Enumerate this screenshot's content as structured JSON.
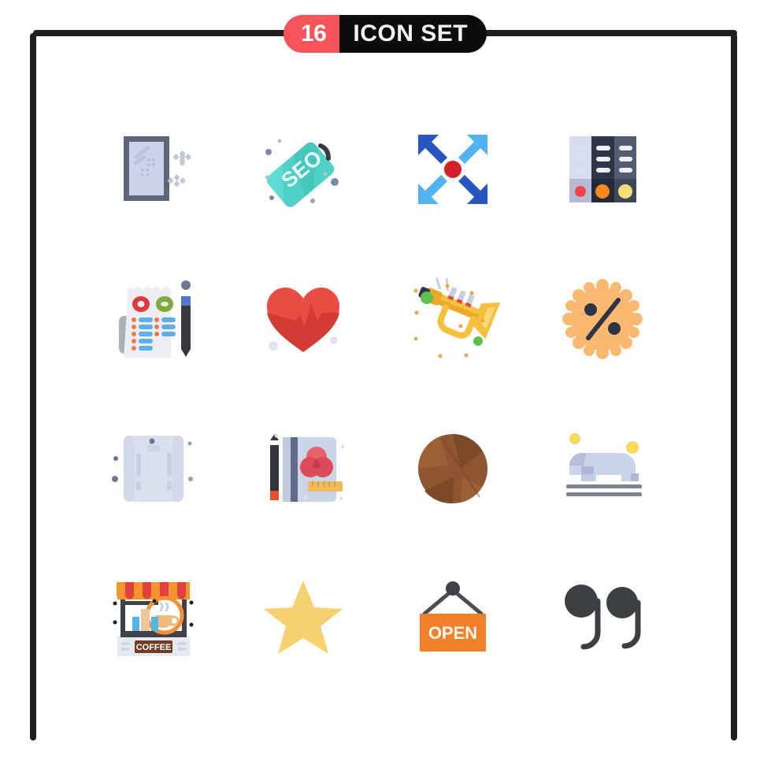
{
  "header": {
    "count": "16",
    "title": "ICON SET",
    "count_bg": "#f4545a",
    "title_bg": "#0d0c0c",
    "text_color": "#ffffff"
  },
  "frame": {
    "color": "#231f20"
  },
  "icons": [
    {
      "name": "window-cleaning-icon",
      "label": "Window Cleaning",
      "row": 1,
      "col": 1,
      "colors": {
        "frame": "#5e6577",
        "glass": "#ccd3ea",
        "streak": "#b9c2de",
        "sparkle": "#c0c7d8"
      }
    },
    {
      "name": "seo-tag-icon",
      "label": "SEO Tag",
      "row": 1,
      "col": 2,
      "text": "SEO",
      "colors": {
        "tag": "#4fd1c6",
        "tag_dark": "#3fc0b5",
        "string": "#393b45",
        "dot": "#7d88a3",
        "dot_light": "#cfd5e4",
        "letters": "#e8faf7"
      }
    },
    {
      "name": "converge-arrows-icon",
      "label": "Converge Arrows",
      "row": 1,
      "col": 3,
      "colors": {
        "dark_blue": "#2855c0",
        "light_blue": "#53b3f0",
        "center": "#d32027"
      }
    },
    {
      "name": "binders-archive-icon",
      "label": "Binders Archive",
      "row": 1,
      "col": 4,
      "colors": {
        "binder_light": "#d7dcef",
        "binder_dark": "#2d3547",
        "binder_slate": "#525d74",
        "base_light": "#b3bcd4",
        "line": "#eef1fb",
        "dot_red": "#f0464a",
        "dot_orange": "#f5881f",
        "dot_yellow": "#fbde78"
      }
    },
    {
      "name": "survey-checklist-icon",
      "label": "Survey Checklist",
      "row": 2,
      "col": 1,
      "colors": {
        "paper": "#eceef3",
        "paper_shadow": "#a9afbd",
        "red": "#e0393c",
        "green": "#7dab3b",
        "bullet": "#e97a4a",
        "line": "#5eaeea",
        "pencil_body": "#38383c",
        "pencil_tip": "#4c79d0"
      }
    },
    {
      "name": "heartbeat-icon",
      "label": "Heartbeat",
      "row": 2,
      "col": 2,
      "colors": {
        "heart": "#e84c43",
        "heart_dark": "#d23c35",
        "dot": "#dfe3ec"
      }
    },
    {
      "name": "trumpet-icon",
      "label": "Trumpet",
      "row": 2,
      "col": 3,
      "colors": {
        "brass": "#f5c13c",
        "brass_dark": "#eaa92c",
        "brass_light": "#fad97a",
        "valve": "#c8d0e0",
        "mouth": "#2f3550",
        "confetti_green": "#5fc04f",
        "confetti_orange": "#f0a44c"
      }
    },
    {
      "name": "discount-badge-icon",
      "label": "Discount Badge",
      "row": 2,
      "col": 4,
      "colors": {
        "badge": "#fbb871",
        "symbol": "#2e3448"
      }
    },
    {
      "name": "scroll-manuscript-icon",
      "label": "Scroll Manuscript",
      "row": 3,
      "col": 1,
      "colors": {
        "paper": "#dbe0ee",
        "paper_dark": "#ccd3e6",
        "rod": "#c1c9dd",
        "dot": "#6d7793",
        "dot_light": "#c5cbdb"
      }
    },
    {
      "name": "sketchbook-icon",
      "label": "Sketchbook",
      "row": 3,
      "col": 2,
      "colors": {
        "cover": "#ccd4e8",
        "spine": "#5f6a86",
        "pencil": "#33353c",
        "pencil_tip": "#e8502a",
        "circle_a": "#e8606c",
        "circle_b": "#dd4a59",
        "circle_c": "#c53a4c",
        "ruler": "#f0b95e",
        "dot": "#dde2ee"
      }
    },
    {
      "name": "basketball-icon",
      "label": "Basketball",
      "row": 3,
      "col": 3,
      "colors": {
        "ball": "#8e5630",
        "ball_dark": "#7d4a28",
        "ball_light": "#9a6036"
      }
    },
    {
      "name": "crawling-baby-icon",
      "label": "Crawling Baby",
      "row": 3,
      "col": 4,
      "colors": {
        "body": "#ccd4ea",
        "body_dark": "#aeb9d6",
        "mat": "#7d8391",
        "sun": "#fbd85e"
      }
    },
    {
      "name": "coffee-stand-icon",
      "label": "Coffee Stand",
      "row": 4,
      "col": 1,
      "text": "COFFEE",
      "colors": {
        "awning_orange": "#f5942c",
        "awning_red": "#e2403c",
        "frame": "#3f4248",
        "base": "#e6e9f0",
        "sign": "#6e4023",
        "sign_text": "#ffffff",
        "cup": "#f0b97e",
        "circle": "#f2913a",
        "bottle_blue": "#54b4e8",
        "bottle_tan": "#f0c79a"
      }
    },
    {
      "name": "star-icon",
      "label": "Star",
      "row": 4,
      "col": 2,
      "colors": {
        "star": "#f7d071"
      }
    },
    {
      "name": "open-sign-icon",
      "label": "Open Sign",
      "row": 4,
      "col": 3,
      "text": "OPEN",
      "colors": {
        "sign": "#f1802a",
        "text": "#fdf6ef",
        "rope": "#4a4d53"
      }
    },
    {
      "name": "quotation-mark-icon",
      "label": "Quotation Mark",
      "row": 4,
      "col": 4,
      "colors": {
        "mark": "#3c3f44"
      }
    }
  ]
}
